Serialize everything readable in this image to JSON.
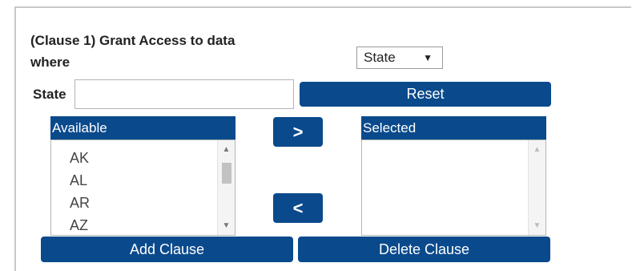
{
  "clause": {
    "heading_line1": "(Clause 1) Grant Access to data",
    "heading_line2": "where",
    "filter_select": {
      "value": "State",
      "caret": "▼"
    },
    "state_label": "State",
    "state_input": {
      "value": "",
      "placeholder": ""
    },
    "reset_label": "Reset",
    "available": {
      "header": "Available",
      "items": [
        "AK",
        "AL",
        "AR",
        "AZ"
      ]
    },
    "selected": {
      "header": "Selected",
      "items": []
    },
    "move_right_label": ">",
    "move_left_label": "<",
    "add_clause_label": "Add Clause",
    "delete_clause_label": "Delete Clause"
  },
  "colors": {
    "accent": "#0a4a8c"
  },
  "icons": {
    "move_right": "chevron-right-icon",
    "move_left": "chevron-left-icon",
    "scroll_up": "scroll-up-arrow-icon",
    "scroll_down": "scroll-down-arrow-icon"
  }
}
